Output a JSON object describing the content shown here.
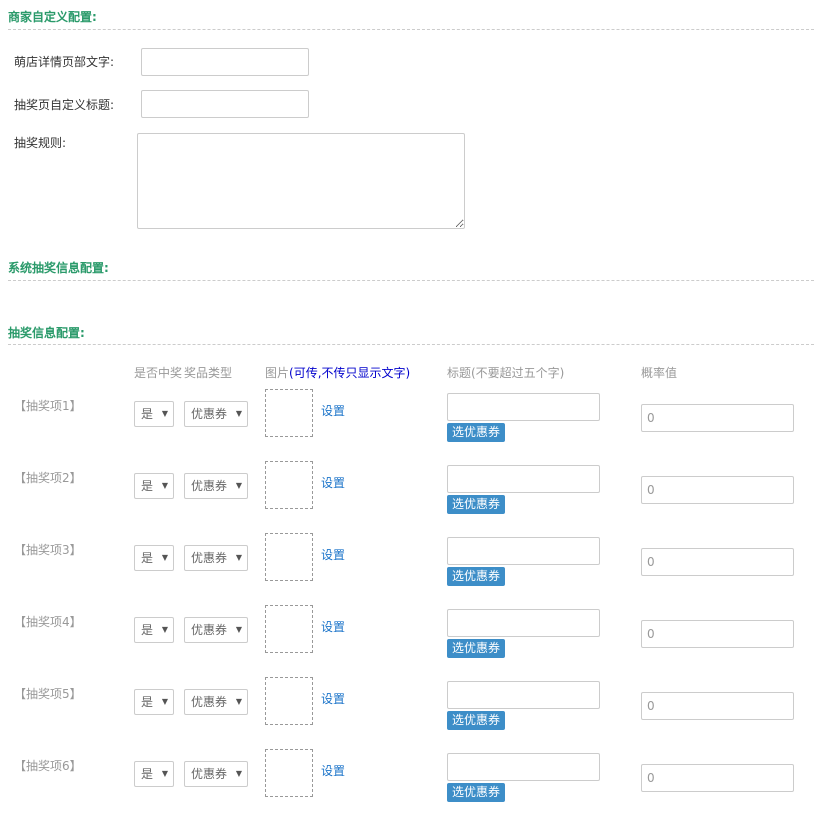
{
  "merchant_section": {
    "title": "商家自定义配置:",
    "shop_header_label": "萌店详情页部文字:",
    "shop_header_value": "",
    "lottery_title_label": "抽奖页自定义标题:",
    "lottery_title_value": "",
    "rules_label": "抽奖规则:",
    "rules_value": ""
  },
  "system_section": {
    "title": "系统抽奖信息配置:"
  },
  "lottery_section": {
    "title": "抽奖信息配置:",
    "headers": {
      "win": "是否中奖",
      "prize_type": "奖品类型",
      "image": "图片",
      "image_note": "(可传,不传只显示文字)",
      "title": "标题(不要超过五个字)",
      "probability": "概率值"
    },
    "set_label": "设置",
    "pick_coupon_label": "选优惠券",
    "items": [
      {
        "label": "【抽奖项1】",
        "win": "是",
        "prize_type": "优惠券",
        "title": "",
        "probability": "0"
      },
      {
        "label": "【抽奖项2】",
        "win": "是",
        "prize_type": "优惠券",
        "title": "",
        "probability": "0"
      },
      {
        "label": "【抽奖项3】",
        "win": "是",
        "prize_type": "优惠券",
        "title": "",
        "probability": "0"
      },
      {
        "label": "【抽奖项4】",
        "win": "是",
        "prize_type": "优惠券",
        "title": "",
        "probability": "0"
      },
      {
        "label": "【抽奖项5】",
        "win": "是",
        "prize_type": "优惠券",
        "title": "",
        "probability": "0"
      },
      {
        "label": "【抽奖项6】",
        "win": "是",
        "prize_type": "优惠券",
        "title": "",
        "probability": "0"
      }
    ]
  }
}
